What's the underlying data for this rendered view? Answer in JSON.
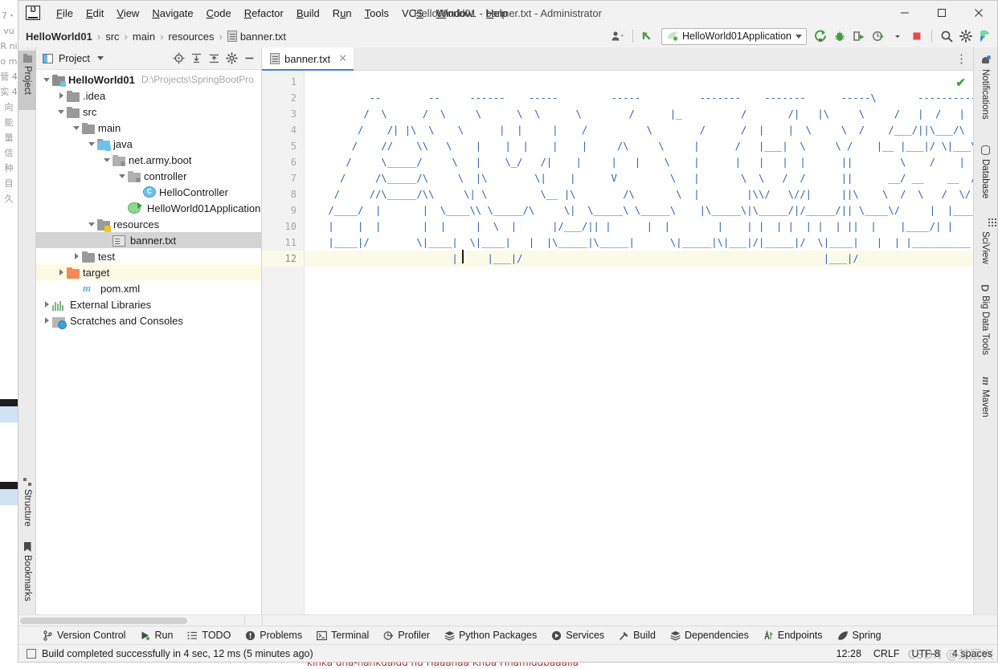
{
  "window": {
    "title": "HelloWorld01 - banner.txt - Administrator",
    "minimize_label": "—",
    "maximize_label": "☐",
    "close_label": "✕"
  },
  "menubar": [
    {
      "pre": "",
      "mn": "F",
      "post": "ile"
    },
    {
      "pre": "",
      "mn": "E",
      "post": "dit"
    },
    {
      "pre": "",
      "mn": "V",
      "post": "iew"
    },
    {
      "pre": "",
      "mn": "N",
      "post": "avigate"
    },
    {
      "pre": "",
      "mn": "C",
      "post": "ode"
    },
    {
      "pre": "",
      "mn": "R",
      "post": "efactor"
    },
    {
      "pre": "",
      "mn": "B",
      "post": "uild"
    },
    {
      "pre": "R",
      "mn": "u",
      "post": "n"
    },
    {
      "pre": "",
      "mn": "T",
      "post": "ools"
    },
    {
      "pre": "VC",
      "mn": "S",
      "post": ""
    },
    {
      "pre": "",
      "mn": "W",
      "post": "indow"
    },
    {
      "pre": "",
      "mn": "H",
      "post": "elp"
    }
  ],
  "navbar": {
    "crumbs": [
      "HelloWorld01",
      "src",
      "main",
      "resources",
      "banner.txt"
    ],
    "separator": "›",
    "run_config": "HelloWorld01Application",
    "icons": [
      {
        "name": "user-avatar-icon"
      },
      {
        "name": "updates-arrow-icon"
      },
      {
        "name": "run-icon"
      },
      {
        "name": "debug-icon"
      },
      {
        "name": "run-with-coverage-icon"
      },
      {
        "name": "profile-icon"
      },
      {
        "name": "stop-icon"
      },
      {
        "name": "search-everywhere-icon"
      },
      {
        "name": "settings-gear-icon"
      },
      {
        "name": "ide-assistant-icon"
      }
    ]
  },
  "left_strip": {
    "top": [
      {
        "label": "Project",
        "icon": "project-folder-icon",
        "active": true
      }
    ],
    "bottom": [
      {
        "label": "Structure",
        "icon": "structure-icon"
      },
      {
        "label": "Bookmarks",
        "icon": "bookmark-icon"
      }
    ]
  },
  "right_strip": [
    {
      "label": "Notifications",
      "icon": "notifications-bell-icon"
    },
    {
      "label": "Database",
      "icon": "database-icon"
    },
    {
      "label": "SciView",
      "icon": "sciview-grid-icon"
    },
    {
      "label": "Big Data Tools",
      "icon": "big-data-tools-icon"
    },
    {
      "label": "Maven",
      "icon": "maven-icon"
    }
  ],
  "project_panel": {
    "title": "Project",
    "actions": [
      "locate-icon",
      "expand-all-icon",
      "collapse-all-icon",
      "settings-gear-icon",
      "hide-icon"
    ],
    "tree": [
      {
        "label": "HelloWorld01",
        "path": "D:\\Projects\\SpringBootPro",
        "indent": 0,
        "arrow": "down",
        "icon": "project-icon",
        "bold": true
      },
      {
        "label": ".idea",
        "indent": 1,
        "arrow": "right",
        "icon": "folder-icon"
      },
      {
        "label": "src",
        "indent": 1,
        "arrow": "down",
        "icon": "folder-icon"
      },
      {
        "label": "main",
        "indent": 2,
        "arrow": "down",
        "icon": "folder-icon"
      },
      {
        "label": "java",
        "indent": 3,
        "arrow": "down",
        "icon": "folder-source-icon"
      },
      {
        "label": "net.army.boot",
        "indent": 4,
        "arrow": "down",
        "icon": "package-icon"
      },
      {
        "label": "controller",
        "indent": 5,
        "arrow": "down",
        "icon": "package-icon"
      },
      {
        "label": "HelloController",
        "indent": 6,
        "arrow": "none",
        "icon": "java-class-icon"
      },
      {
        "label": "HelloWorld01Application",
        "indent": 5,
        "arrow": "none",
        "icon": "spring-application-icon"
      },
      {
        "label": "resources",
        "indent": 3,
        "arrow": "down",
        "icon": "folder-resources-icon"
      },
      {
        "label": "banner.txt",
        "indent": 4,
        "arrow": "none",
        "icon": "text-file-icon",
        "selected": true
      },
      {
        "label": "test",
        "indent": 2,
        "arrow": "right",
        "icon": "folder-icon"
      },
      {
        "label": "target",
        "indent": 1,
        "arrow": "right",
        "icon": "folder-target-icon",
        "highlight": true
      },
      {
        "label": "pom.xml",
        "indent": 1,
        "arrow": "none",
        "icon": "maven-pom-icon"
      },
      {
        "label": "External Libraries",
        "indent": 0,
        "arrow": "right",
        "icon": "libraries-icon"
      },
      {
        "label": "Scratches and Consoles",
        "indent": 0,
        "arrow": "right",
        "icon": "scratches-icon"
      }
    ]
  },
  "editor": {
    "tab": {
      "label": "banner.txt",
      "icon": "text-file-icon",
      "close": "✕"
    },
    "more_actions": "⋮",
    "inspection_status": "✔",
    "line_numbers": [
      1,
      2,
      3,
      4,
      5,
      6,
      7,
      8,
      9,
      10,
      11,
      12
    ],
    "current_line": 12,
    "lines": [
      "",
      "           --        --     ------    -----         -----          -------    -------      -----\\       ------------",
      "          /  \\      /  \\     \\      \\  \\      \\        /      |_          /       /|   |\\     \\     /   |  /   |  \\",
      "         /    /| |\\  \\    \\      |  |     |    /          \\        /      /  |    |  \\     \\  /    /___/||\\___/\\  \\\\___/|",
      "        /    //    \\\\   \\    |    |  |    |    |     /\\     \\     |      /   |___|  \\     \\ /    |__ |___|/ \\|___\\  \\___|/",
      "       /     \\_____/     \\   |    \\_/   /|    |     |   |    \\    |      |   |   |  |      ||        \\    /    |     |",
      "      /     /\\_____/\\     \\  |\\        \\|    |      V         \\   |       \\  \\   /  /      ||      __/ __    __  /   / __",
      "     /     //\\_____/\\\\     \\| \\         \\__ |\\        /\\       \\  |        |\\\\/   \\//|     ||\\    \\  /  \\   /  \\/   /_/  |",
      "    /____/  |       |  \\____\\\\ \\_____/\\     \\|  \\_____\\ \\_____\\    |\\_____\\|\\_____/|/_____/|| \\____\\/     |  |__________/|",
      "    |    |  |       |  |     |  \\  |      |/___/|| |      |  |        |    | |  | |  | |  | ||  |    |____/| |         | /",
      "    |____|/        \\|____|  \\|____|   |  |\\_____|\\_____|      \\|_____|\\|___|/|_____|/  \\|____|   |  | |__________|/",
      "                         |     |___|/                                                   |___|/"
    ]
  },
  "bottom_tools": [
    {
      "label": "Version Control",
      "icon": "vcs-branch-icon"
    },
    {
      "label": "Run",
      "icon": "run-triangle-icon"
    },
    {
      "label": "TODO",
      "icon": "todo-list-icon"
    },
    {
      "label": "Problems",
      "icon": "problems-icon"
    },
    {
      "label": "Terminal",
      "icon": "terminal-icon"
    },
    {
      "label": "Profiler",
      "icon": "profiler-icon"
    },
    {
      "label": "Python Packages",
      "icon": "packages-icon"
    },
    {
      "label": "Services",
      "icon": "services-icon"
    },
    {
      "label": "Build",
      "icon": "build-hammer-icon"
    },
    {
      "label": "Dependencies",
      "icon": "dependencies-icon"
    },
    {
      "label": "Endpoints",
      "icon": "endpoints-icon"
    },
    {
      "label": "Spring",
      "icon": "spring-leaf-icon"
    }
  ],
  "statusbar": {
    "message": "Build completed successfully in 4 sec, 12 ms (5 minutes ago)",
    "position": "12:28",
    "line_separator": "CRLF",
    "encoding": "UTF-8",
    "indent": "4 spaces",
    "watermark": "CSDN @某层兴"
  },
  "colors": {
    "accent": "#4083c9",
    "ascii_text": "#2f5fb3",
    "selection": "#d4d4d4",
    "highlight_row": "#fdfae4",
    "success": "#42a142",
    "stop": "#e04a4a"
  },
  "desktop": {
    "left_edge_text": "7・vu R ni o m 管 4 实 4 向 能 量 信 种 目 久",
    "bottom_edge_text": "kinka una-hankdaldd nu Haaahaa Khba Hhamlddbaaalla"
  }
}
